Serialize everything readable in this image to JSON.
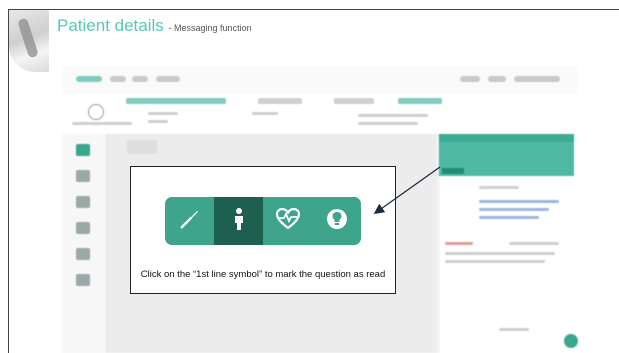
{
  "slide": {
    "title": "Patient details",
    "subtitle": "- Messaging function"
  },
  "callout": {
    "text": "Click on the “1st line symbol” to mark the question as read"
  },
  "toolbar_icons": [
    {
      "name": "wrench-icon",
      "active": false
    },
    {
      "name": "first-line-person-icon",
      "active": true
    },
    {
      "name": "heart-pulse-icon",
      "active": false
    },
    {
      "name": "lightbulb-icon",
      "active": false
    }
  ],
  "colors": {
    "title": "#5cc6b6",
    "toolbar_green": "#3ea58c",
    "toolbar_active": "#1d604f",
    "panel_teal": "#4fb9a3"
  }
}
